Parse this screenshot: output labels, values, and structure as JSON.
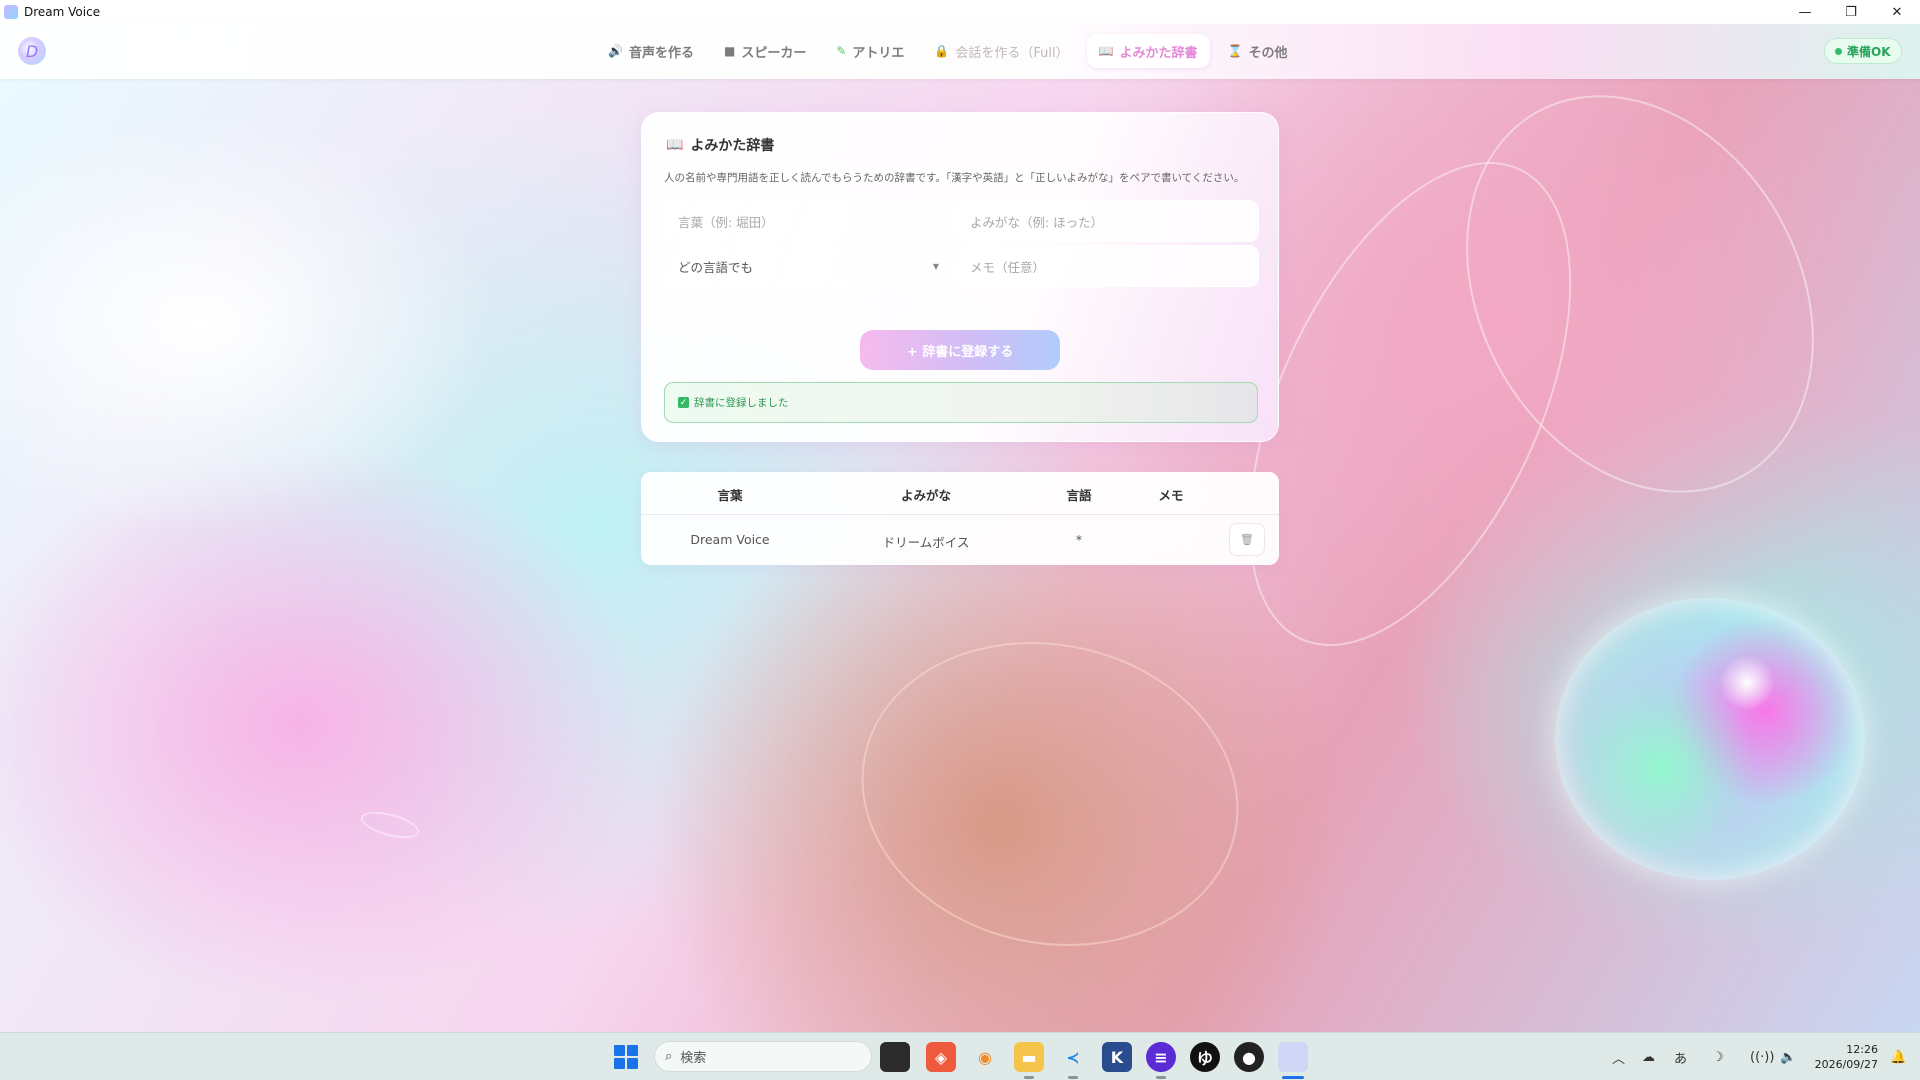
{
  "window": {
    "title": "Dream Voice",
    "minimize": "—",
    "restore": "❐",
    "close": "✕"
  },
  "header": {
    "logo_glyph": "D",
    "tabs": [
      {
        "icon": "🔊",
        "label": "音声を作る"
      },
      {
        "icon": "■",
        "label": "スピーカー"
      },
      {
        "icon": "✎",
        "label": "アトリエ"
      },
      {
        "icon": "🔒",
        "label": "会話を作る（Full）"
      },
      {
        "icon": "📖",
        "label": "よみかた辞書"
      },
      {
        "icon": "⌛",
        "label": "その他"
      }
    ],
    "active_tab": "よみかた辞書",
    "status": "準備OK"
  },
  "dictionary": {
    "icon": "📖",
    "title": "よみかた辞書",
    "description": "人の名前や専門用語を正しく読んでもらうための辞書です。「漢字や英語」と「正しいよみがな」をペアで書いてください。",
    "word_placeholder": "言葉（例: 堀田）",
    "reading_placeholder": "よみがな（例: ほった）",
    "language_value": "どの言語でも",
    "memo_placeholder": "メモ（任意）",
    "add_button": "+ 辞書に登録する",
    "notice": "辞書に登録しました"
  },
  "table": {
    "headers": [
      "言葉",
      "よみがな",
      "言語",
      "メモ"
    ],
    "rows": [
      {
        "word": "Dream Voice",
        "reading": "ドリームボイス",
        "language": "*",
        "memo": ""
      }
    ],
    "delete_icon": "🗑"
  },
  "taskbar": {
    "search_placeholder": "検索",
    "clock_time": "12:26",
    "clock_date": "2026/09/27"
  },
  "colors": {
    "accent_pink": "#e48ad7",
    "status_green": "#2fbf6b"
  }
}
